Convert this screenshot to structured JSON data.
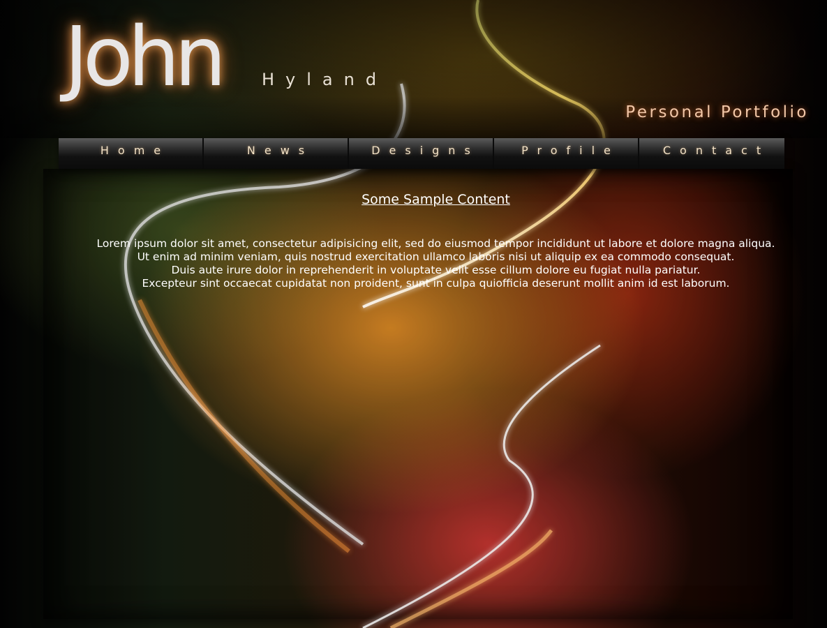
{
  "header": {
    "first_name": "John",
    "last_name": "Hyland",
    "tagline": "Personal Portfolio"
  },
  "nav": {
    "items": [
      {
        "label": "Home"
      },
      {
        "label": "News"
      },
      {
        "label": "Designs"
      },
      {
        "label": "Profile"
      },
      {
        "label": "Contact"
      }
    ]
  },
  "main": {
    "heading": "Some Sample Content",
    "paragraph_lines": [
      "Lorem ipsum dolor sit amet, consectetur adipisicing elit, sed do eiusmod tempor incididunt ut labore et dolore magna aliqua.",
      "Ut enim ad minim veniam, quis nostrud exercitation ullamco laboris nisi ut aliquip ex ea commodo consequat.",
      "Duis aute irure dolor in reprehenderit in voluptate velit esse cillum dolore eu fugiat nulla pariatur.",
      "Excepteur sint occaecat cupidatat non proident, sunt in culpa quiofficia deserunt mollit anim id est laborum."
    ]
  },
  "colors": {
    "accent_orange": "#f0962a",
    "accent_red": "#e03c3c",
    "swoosh_yellow": "#e8e070",
    "tagline": "#f2c7a8"
  }
}
